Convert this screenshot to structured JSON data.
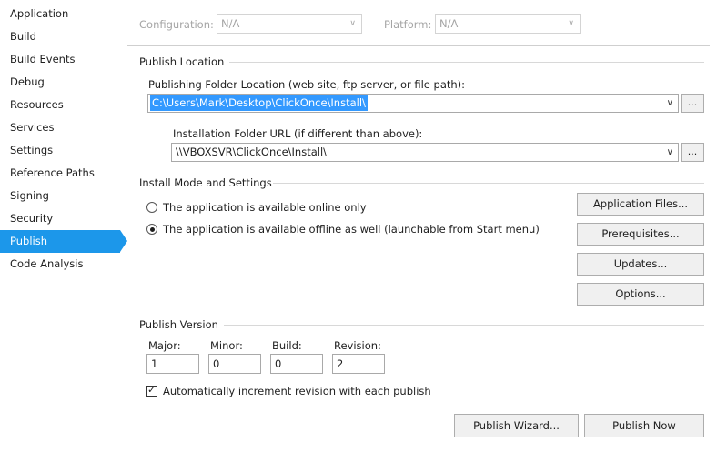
{
  "sidebar": {
    "items": [
      {
        "label": "Application"
      },
      {
        "label": "Build"
      },
      {
        "label": "Build Events"
      },
      {
        "label": "Debug"
      },
      {
        "label": "Resources"
      },
      {
        "label": "Services"
      },
      {
        "label": "Settings"
      },
      {
        "label": "Reference Paths"
      },
      {
        "label": "Signing"
      },
      {
        "label": "Security"
      },
      {
        "label": "Publish"
      },
      {
        "label": "Code Analysis"
      }
    ],
    "active": "Publish",
    "accent_color": "#1c97ea"
  },
  "top_bar": {
    "configuration_label": "Configuration:",
    "configuration_value": "N/A",
    "platform_label": "Platform:",
    "platform_value": "N/A"
  },
  "publish_location": {
    "section_title": "Publish Location",
    "folder_label": "Publishing Folder Location (web site, ftp server, or file path):",
    "folder_value": "C:\\Users\\Mark\\Desktop\\ClickOnce\\Install\\",
    "install_url_label": "Installation Folder URL (if different than above):",
    "install_url_value": "\\\\VBOXSVR\\ClickOnce\\Install\\",
    "browse_label": "..."
  },
  "install_mode": {
    "section_title": "Install Mode and Settings",
    "options": [
      {
        "label": "The application is available online only",
        "selected": false
      },
      {
        "label": "The application is available offline as well (launchable from Start menu)",
        "selected": true
      }
    ],
    "buttons": {
      "application_files": "Application Files...",
      "prerequisites": "Prerequisites...",
      "updates": "Updates...",
      "options": "Options..."
    }
  },
  "publish_version": {
    "section_title": "Publish Version",
    "major_label": "Major:",
    "major_value": "1",
    "minor_label": "Minor:",
    "minor_value": "0",
    "build_label": "Build:",
    "build_value": "0",
    "revision_label": "Revision:",
    "revision_value": "2",
    "auto_increment_label": "Automatically increment revision with each publish",
    "auto_increment_checked": true
  },
  "footer": {
    "publish_wizard": "Publish Wizard...",
    "publish_now": "Publish Now"
  }
}
